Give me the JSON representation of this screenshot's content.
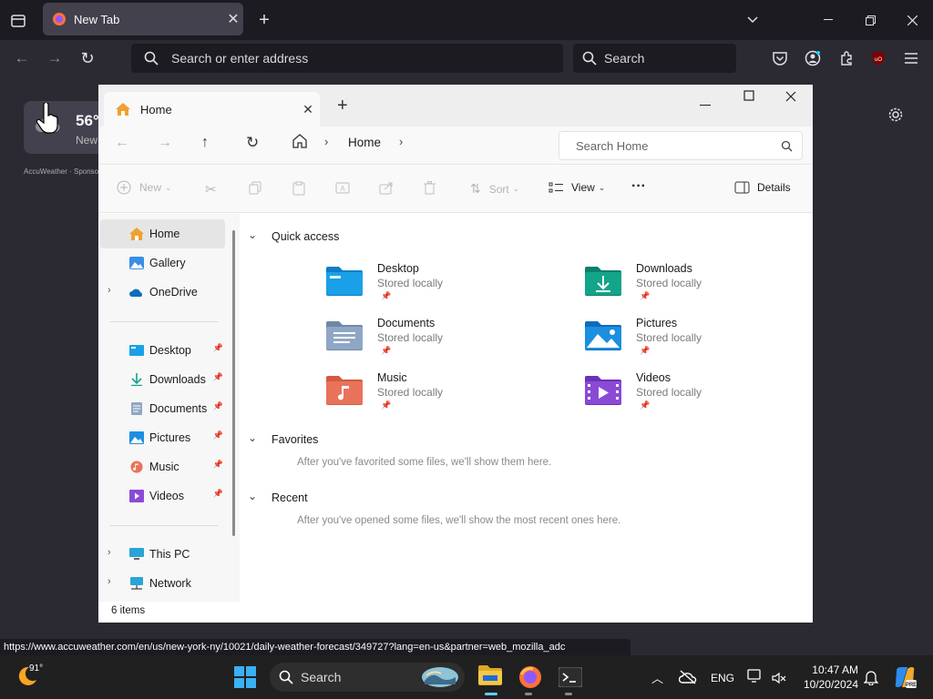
{
  "browser": {
    "tab_title": "New Tab",
    "address_placeholder": "Search or enter address",
    "search_placeholder": "Search",
    "status_url": "https://www.accuweather.com/en/us/new-york-ny/10021/daily-weather-forecast/349727?lang=en-us&partner=web_mozilla_adc"
  },
  "weather": {
    "temp": "56°",
    "location": "New",
    "sponsor": "AccuWeather · Sponsored"
  },
  "explorer": {
    "tab_title": "Home",
    "breadcrumb": "Home",
    "search_placeholder": "Search Home",
    "toolbar": {
      "new": "New",
      "sort": "Sort",
      "view": "View",
      "more": "···",
      "details": "Details"
    },
    "sidebar": {
      "top": [
        {
          "label": "Home"
        },
        {
          "label": "Gallery"
        },
        {
          "label": "OneDrive"
        }
      ],
      "pinned": [
        {
          "label": "Desktop"
        },
        {
          "label": "Downloads"
        },
        {
          "label": "Documents"
        },
        {
          "label": "Pictures"
        },
        {
          "label": "Music"
        },
        {
          "label": "Videos"
        }
      ],
      "bottom": [
        {
          "label": "This PC"
        },
        {
          "label": "Network"
        }
      ]
    },
    "sections": {
      "quick_access": "Quick access",
      "favorites": "Favorites",
      "favorites_note": "After you've favorited some files, we'll show them here.",
      "recent": "Recent",
      "recent_note": "After you've opened some files, we'll show the most recent ones here."
    },
    "quick_access": [
      {
        "name": "Desktop",
        "status": "Stored locally",
        "color": "#1aa0e8"
      },
      {
        "name": "Downloads",
        "status": "Stored locally",
        "color": "#12a58a"
      },
      {
        "name": "Documents",
        "status": "Stored locally",
        "color": "#8fa7c4"
      },
      {
        "name": "Pictures",
        "status": "Stored locally",
        "color": "#1c8fe0"
      },
      {
        "name": "Music",
        "status": "Stored locally",
        "color": "#e8735a"
      },
      {
        "name": "Videos",
        "status": "Stored locally",
        "color": "#8a4ad6"
      }
    ],
    "status_text": "6 items"
  },
  "taskbar": {
    "weather_temp": "91°",
    "search_label": "Search",
    "lang": "ENG",
    "time": "10:47 AM",
    "date": "10/20/2024"
  }
}
